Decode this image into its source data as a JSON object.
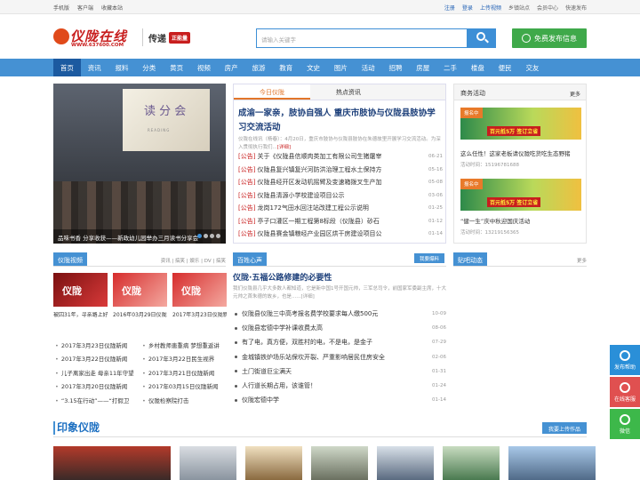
{
  "topbar": {
    "left": [
      "手机版",
      "客户端",
      "收藏本站"
    ],
    "register": "注册",
    "login": "登录",
    "upload_video": "上传视频",
    "site_nav": "乡镇站点",
    "member": "会员中心",
    "quick_pub": "快速发布"
  },
  "header": {
    "logo_text": "仪陇在线",
    "logo_url": "WWW.637600.COM",
    "slogan": "传递",
    "slogan_badge": "正能量",
    "search_placeholder": "请输入关键字",
    "publish_btn": "免费发布信息"
  },
  "nav": [
    "首页",
    "资讯",
    "报料",
    "分类",
    "黄页",
    "视频",
    "房产",
    "旅游",
    "教育",
    "文史",
    "图片",
    "活动",
    "招聘",
    "房屋",
    "二手",
    "楼盘",
    "便民",
    "交友"
  ],
  "slide": {
    "board_title": "读 分 会",
    "board_sub": "READING",
    "caption": "品味书香 分享收获——新政幼儿园举办三月读书分享会"
  },
  "news": {
    "tab1": "今日仪陇",
    "tab2": "热点资讯",
    "headline": "成渝一家亲，肢协自强人 重庆市肢协与仪陇县肢协学习交流活动",
    "summary": "仪陇在线讯（杨春）：4月20日，重庆市肢协与仪陇县肢协在朱德故里开展学习交流活动。为深入贯彻执行我们...",
    "more": "[详细]",
    "items": [
      {
        "tag": "[公告]",
        "title": "关于《仪陇县信顺肉类加工有限公司生猪屠宰",
        "date": "06-21"
      },
      {
        "tag": "[公告]",
        "title": "仪陇县复兴镇复兴河防洪治理工程水土保持方",
        "date": "05-16"
      },
      {
        "tag": "[公告]",
        "title": "仪陇县经开区发动机摇臂及变速箱拨叉生产加",
        "date": "05-08"
      },
      {
        "tag": "[公告]",
        "title": "仪陇县清源小学校建设项目公示",
        "date": "03-06"
      },
      {
        "tag": "[公告]",
        "title": "龙岗172气田水回注站改建工程公示说明",
        "date": "01-25"
      },
      {
        "tag": "[公告]",
        "title": "亭子口灌区一期工程第8标段（仪陇县）砂石",
        "date": "01-12"
      },
      {
        "tag": "[公告]",
        "title": "仪陇县赛金镇粮经产业园区烘干房建设项目公",
        "date": "01-14"
      }
    ]
  },
  "biz": {
    "title": "商务活动",
    "more": "更多",
    "cards": [
      {
        "tag": "报名中",
        "banner": "百元抵5万 签订立省",
        "title": "这么任性！这家老板请仪陇吃货吃生态野猪",
        "contact": "活动时间：15196781688"
      },
      {
        "tag": "报名中",
        "banner": "百元抵5万 签订立省",
        "title": "“健一生”庆中秋迎国庆活动",
        "contact": "活动时间：13219156365"
      }
    ]
  },
  "sections": {
    "video": "仪陇视频",
    "video_links": "资讯 | 搞笑 | 娱乐 | DV | 搞笑",
    "voice": "百姓心声",
    "voice_btn": "我要爆料",
    "tie": "贴吧动态",
    "tie_more": "更多"
  },
  "videos": {
    "thumbs": [
      {
        "label": "仪陇",
        "caption": "被囚31年，寻亲路上好想你--寨生父"
      },
      {
        "label": "仪陇",
        "caption": "2016年03月29日仪陇新闻"
      },
      {
        "label": "仪陇",
        "caption": "2017年3月23日仪陇新闻"
      }
    ],
    "list": [
      [
        "2017年3月23日仪陇新闻",
        "乡村教师患重病 梦想重返讲"
      ],
      [
        "2017年3月22日仪陇新闻",
        "2017年3月22日民生视界"
      ],
      [
        "儿子离家出走 母亲11年守望",
        "2017年3月21日仪陇新闻"
      ],
      [
        "2017年3月20日仪陇新闻",
        "2017年03月15日仪陇新闻"
      ],
      [
        "“3.15在行动”——“打假卫",
        "仪陇检察院打击"
      ]
    ]
  },
  "voice": {
    "headline": "仪陇·五福公路修建的必要性",
    "summary": "我们仪陇县几乎大多数人都知道，它是新中国1号开国元帅，三军总司令，前国家军委副主席，十大元帅之首朱德的故乡，也是......[详细]",
    "items": [
      {
        "title": "仪陇县仪陇三中高考报名费学校要求每人缴500元",
        "date": "10-09"
      },
      {
        "title": "仪陇县宏德中学补课收费太高",
        "date": "08-06"
      },
      {
        "title": "有了电，真方便，双胜村的电，不是电，是金子",
        "date": "07-29"
      },
      {
        "title": "金城镇铁炉场乐站保坎开裂、严重影响居民住房安全",
        "date": "02-06"
      },
      {
        "title": "土门街道巨尘满天",
        "date": "01-31"
      },
      {
        "title": "人行道长期占用，该谁管！",
        "date": "01-24"
      },
      {
        "title": "仪陇宏德中学",
        "date": "01-14"
      }
    ]
  },
  "impress": {
    "title": "印象仪陇",
    "btn": "我要上传作品"
  },
  "float": [
    "发布帮助",
    "在线客服",
    "微信"
  ]
}
